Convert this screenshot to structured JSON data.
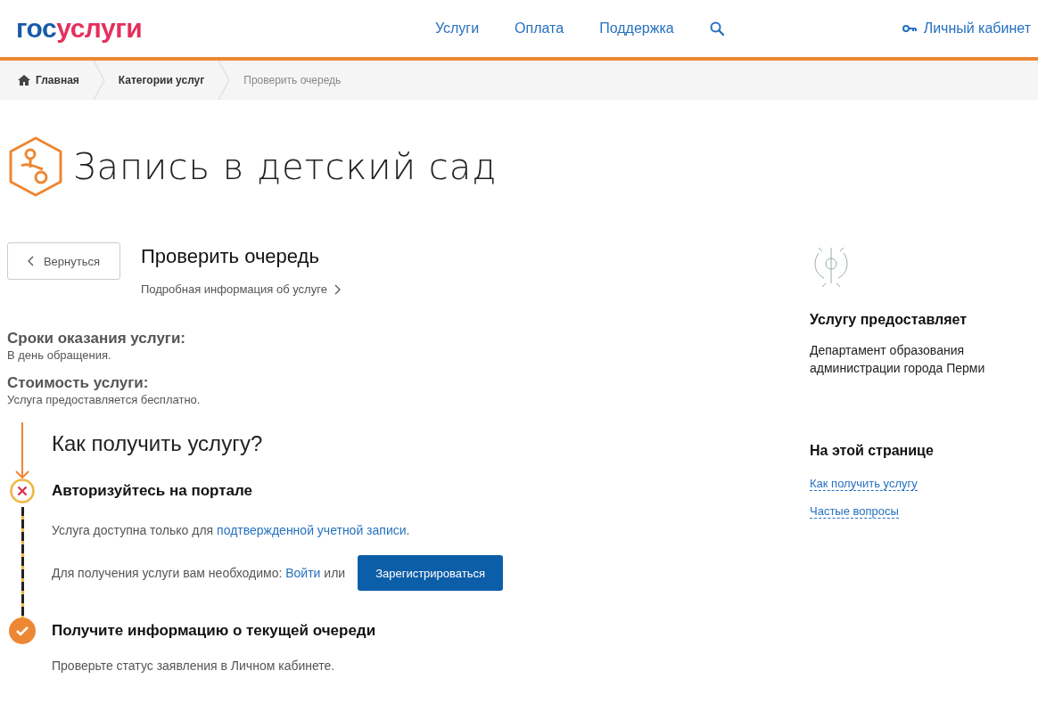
{
  "header": {
    "logo": {
      "part_1": "гос",
      "part_2": "услуги"
    },
    "nav": [
      "Услуги",
      "Оплата",
      "Поддержка"
    ],
    "account": "Личный кабинет"
  },
  "breadcrumbs": [
    {
      "label": "Главная",
      "current": false
    },
    {
      "label": "Категории услуг",
      "current": false
    },
    {
      "label": "Проверить очередь",
      "current": true
    }
  ],
  "page_title": "Запись в детский сад",
  "back_button": "Вернуться",
  "service": {
    "title": "Проверить очередь",
    "details_link": "Подробная информация об услуге",
    "facts": [
      {
        "label": "Сроки оказания услуги:",
        "value": "В день обращения."
      },
      {
        "label": "Стоимость услуги:",
        "value": "Услуга предоставляется бесплатно."
      }
    ]
  },
  "how_to": {
    "title": "Как получить услугу?",
    "steps": [
      {
        "kind": "failed",
        "title": "Авторизуйтесь на портале",
        "note": {
          "before": "Услуга доступна только для ",
          "link": "подтвержденной учетной записи",
          "after": "."
        },
        "action": {
          "before": "Для получения услуги вам необходимо: ",
          "link": "Войти",
          "after": " или",
          "button": "Зарегистрироваться"
        }
      },
      {
        "kind": "done",
        "title": "Получите информацию о текущей очереди",
        "text": "Проверьте статус заявления в Личном кабинете."
      }
    ]
  },
  "provider": {
    "title": "Услугу предоставляет",
    "name": "Департамент образования администрации города Перми"
  },
  "on_this_page": {
    "title": "На этой странице",
    "links": [
      "Как получить услугу",
      "Частые вопросы"
    ]
  }
}
